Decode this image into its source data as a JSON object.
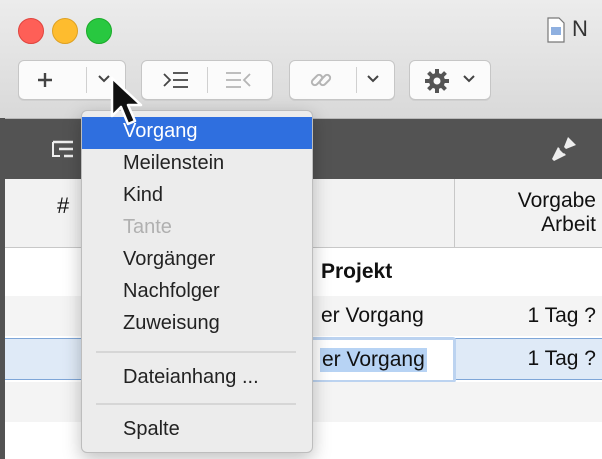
{
  "window": {
    "title": "N"
  },
  "toolbar": {
    "add_icon": "plus-icon",
    "dropdown_icon": "chevron-down-icon",
    "indent_icon": "indent-icon",
    "outdent_icon": "outdent-icon",
    "link_icon": "link-icon",
    "settings_icon": "gear-icon"
  },
  "table": {
    "header_number": "#",
    "header_work": [
      "Vorgabe",
      "Arbeit"
    ],
    "rows": [
      {
        "name": "Projekt",
        "work": ""
      },
      {
        "name": "er Vorgang",
        "work": "1 Tag ?"
      },
      {
        "name": "er Vorgang",
        "work": "1 Tag ?",
        "editing": true
      }
    ]
  },
  "menu": {
    "items": [
      {
        "label": "Vorgang",
        "state": "selected"
      },
      {
        "label": "Meilenstein",
        "state": "enabled"
      },
      {
        "label": "Kind",
        "state": "enabled"
      },
      {
        "label": "Tante",
        "state": "disabled"
      },
      {
        "label": "Vorgänger",
        "state": "enabled"
      },
      {
        "label": "Nachfolger",
        "state": "enabled"
      },
      {
        "label": "Zuweisung",
        "state": "enabled"
      },
      {
        "label": "Dateianhang ...",
        "state": "enabled"
      },
      {
        "label": "Spalte",
        "state": "enabled"
      }
    ]
  },
  "colors": {
    "accent": "#2f6fdf",
    "darkbar": "#535353",
    "selection": "#dfeaf7"
  }
}
